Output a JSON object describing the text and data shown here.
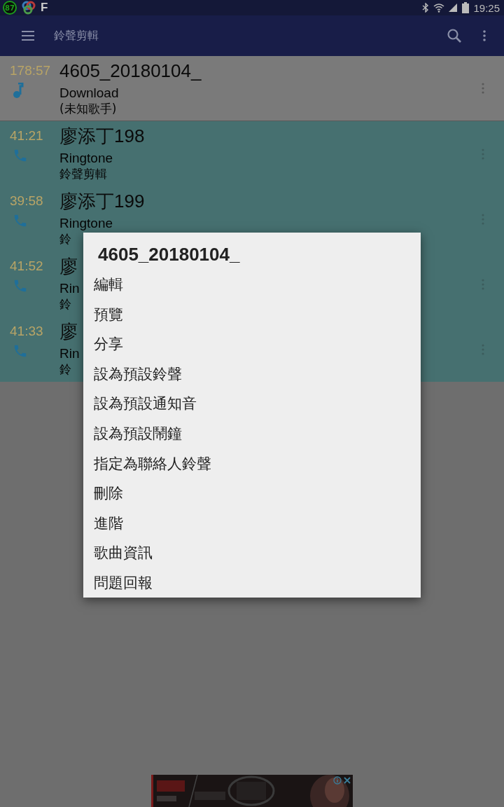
{
  "status_bar": {
    "badge": "87",
    "letter": "F",
    "time": "19:25"
  },
  "app_bar": {
    "title": "鈴聲剪輯"
  },
  "rows": [
    {
      "duration": "178:57",
      "title": "4605_20180104_",
      "line_1": "Download",
      "line_2": "(未知歌手)",
      "kind": "music",
      "selected": false
    },
    {
      "duration": "41:21",
      "title": "廖添丁198",
      "line_1": "Ringtone",
      "line_2": "鈴聲剪輯",
      "kind": "ringtone",
      "selected": true
    },
    {
      "duration": "39:58",
      "title": "廖添丁199",
      "line_1": "Ringtone",
      "line_2": "鈴",
      "kind": "ringtone",
      "selected": true
    },
    {
      "duration": "41:52",
      "title": "廖",
      "line_1": "Rin",
      "line_2": "鈴",
      "kind": "ringtone",
      "selected": true
    },
    {
      "duration": "41:33",
      "title": "廖",
      "line_1": "Rin",
      "line_2": "鈴",
      "kind": "ringtone",
      "selected": true
    }
  ],
  "dialog": {
    "title": "4605_20180104_",
    "items": [
      "編輯",
      "預覽",
      "分享",
      "設為預設鈴聲",
      "設為預設通知音",
      "設為預設鬧鐘",
      "指定為聯絡人鈴聲",
      "刪除",
      "進階",
      "歌曲資訊",
      "問題回報"
    ]
  }
}
